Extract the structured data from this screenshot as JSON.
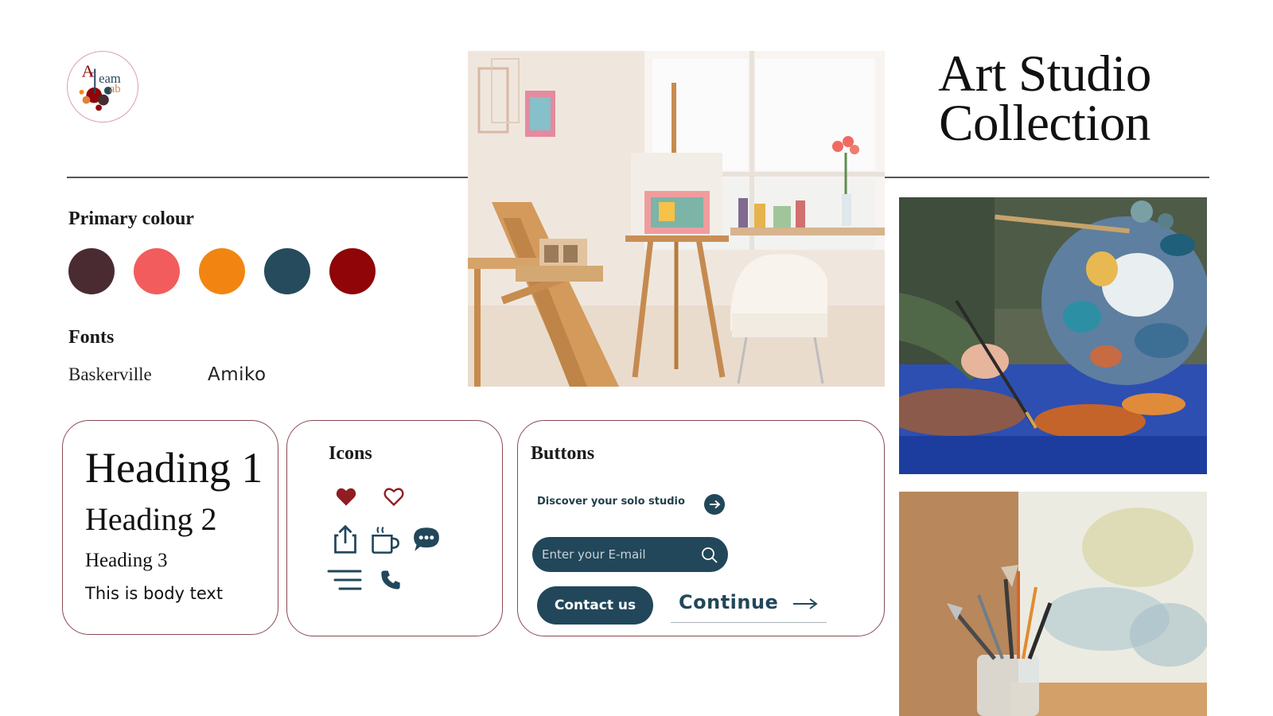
{
  "title": {
    "line1": "Art Studio",
    "line2": "Collection"
  },
  "logo": {
    "alt": "Art Team Lab logo"
  },
  "primary_colour": {
    "label": "Primary colour",
    "swatches": [
      "#4a2b32",
      "#f35c5c",
      "#f28512",
      "#264b5c",
      "#8f0508"
    ]
  },
  "fonts": {
    "label": "Fonts",
    "serif_name": "Baskerville",
    "sans_name": "Amiko"
  },
  "typography": {
    "heading1": "Heading 1",
    "heading2": "Heading 2",
    "heading3": "Heading 3",
    "body": "This is body text"
  },
  "icons_card": {
    "title": "Icons",
    "icons": [
      "heart-filled-icon",
      "heart-outline-icon",
      "share-icon",
      "coffee-cup-icon",
      "chat-bubble-icon",
      "menu-icon",
      "phone-icon"
    ]
  },
  "buttons_card": {
    "title": "Buttons",
    "link_label": "Discover your solo studio",
    "email_placeholder": "Enter your E-mail",
    "contact_label": "Contact us",
    "continue_label": "Continue"
  },
  "colors": {
    "accent_dark": "#22475a",
    "heart_red": "#8f1d22",
    "card_border": "#8a4a52"
  }
}
